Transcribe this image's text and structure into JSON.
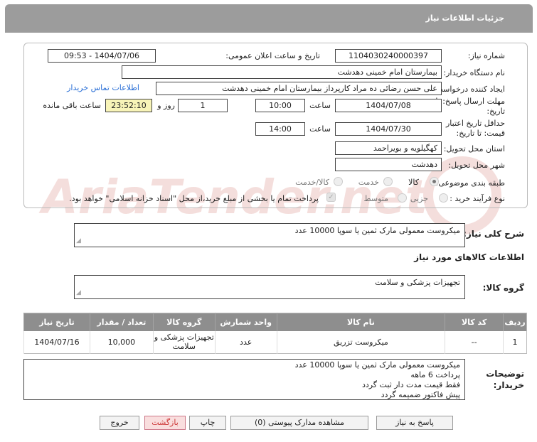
{
  "header": {
    "title": "جزئیات اطلاعات نیاز"
  },
  "fields": {
    "need_number_label": "شماره نیاز:",
    "need_number": "1104030240000397",
    "announce_label": "تاریخ و ساعت اعلان عمومی:",
    "announce_value": "1404/07/06 - 09:53",
    "buyer_org_label": "نام دستگاه خریدار:",
    "buyer_org": "بیمارستان امام خمینی دهدشت",
    "creator_label": "ایجاد کننده درخواست:",
    "creator": "علی حسن رضائی ده مراد کارپرداز بیمارستان امام خمینی دهدشت",
    "contact_link": "اطلاعات تماس خریدار",
    "deadline_label_1": "مهلت ارسال پاسخ: تا",
    "deadline_label_2": "تاریخ:",
    "deadline_date": "1404/07/08",
    "time_label": "ساعت",
    "deadline_time": "10:00",
    "days_value": "1",
    "days_label": "روز و",
    "remaining_time": "23:52:10",
    "remaining_label": "ساعت باقی مانده",
    "validity_label_1": "حداقل تاریخ اعتبار",
    "validity_label_2": "قیمت: تا تاریخ:",
    "validity_date": "1404/07/30",
    "validity_time": "14:00",
    "province_label": "استان محل تحویل:",
    "province": "کهگیلویه و بویراحمد",
    "city_label": "شهر محل تحویل:",
    "city": "دهدشت",
    "category_label": "طبقه بندی موضوعی:",
    "category_options": [
      "کالا",
      "خدمت",
      "کالا/خدمت"
    ],
    "process_label": "نوع فرآیند خرید :",
    "process_options": [
      "جزیی",
      "متوسط"
    ],
    "payment_note": "پرداخت تمام یا بخشی از مبلغ خرید،از محل \"اسناد خزانه اسلامی\" خواهد بود."
  },
  "summary": {
    "label": "شرح کلی نیاز:",
    "text": "میکروست معمولی مارک ثمین یا سوپا 10000 عدد"
  },
  "goods_section": {
    "title": "اطلاعات کالاهای مورد نیاز",
    "group_label": "گروه کالا:",
    "group_value": "تجهیزات پزشکی و سلامت"
  },
  "table": {
    "headers": [
      "ردیف",
      "کد کالا",
      "نام کالا",
      "واحد شمارش",
      "گروه کالا",
      "تعداد / مقدار",
      "تاریخ نیاز"
    ],
    "rows": [
      {
        "row": "1",
        "code": "--",
        "name": "میکروست تزریق",
        "unit": "عدد",
        "group": "تجهیزات پزشکی و سلامت",
        "qty": "10,000",
        "date": "1404/07/16"
      }
    ]
  },
  "buyer_notes": {
    "label_1": "توضیحات",
    "label_2": "خریدار:",
    "lines": [
      "میکروست معمولی مارک ثمین یا سوپا 10000 عدد",
      "پرداخت 6 ماهه",
      "فقط قیمت مدت دار ثبت گردد",
      "پیش فاکتور ضمیمه گردد"
    ]
  },
  "buttons": {
    "reply": "پاسخ به نیاز",
    "attachments": "مشاهده مدارک پیوستی (0)",
    "print": "چاپ",
    "back": "بازگشت",
    "exit": "خروج"
  },
  "watermark": {
    "text": "AriaTender.net"
  },
  "colors": {
    "title_bar": "#9c9c9c",
    "table_header": "#8e8e8e",
    "link": "#2a6fd6",
    "timer_bg": "#f8f4b8",
    "exit_text": "#cc3333"
  }
}
